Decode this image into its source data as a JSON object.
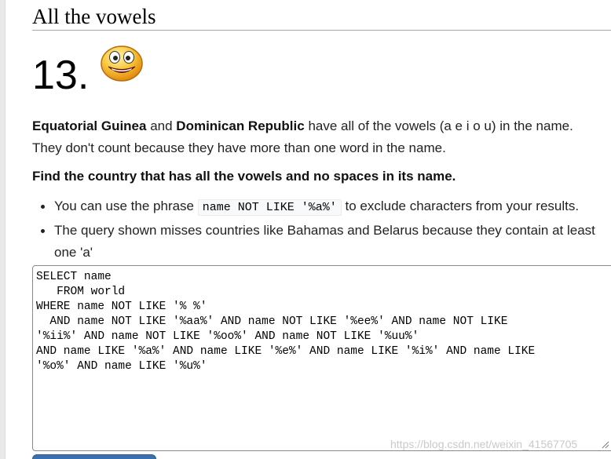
{
  "page": {
    "heading": "All the vowels",
    "question_number": "13.",
    "smiley_icon": "smiley-face-icon"
  },
  "intro": {
    "country1": "Equatorial Guinea",
    "conj": " and ",
    "country2": "Dominican Republic",
    "rest": " have all of the vowels (a e i o u) in the name.",
    "line2": "They don't count because they have more than one word in the name."
  },
  "task": "Find the country that has all the vowels and no spaces in its name.",
  "bullets": {
    "b1_before": "You can use the phrase ",
    "b1_code": "name NOT LIKE '%a%'",
    "b1_after": " to exclude characters from your results.",
    "b2_line1": "The query shown misses countries like Bahamas and Belarus because they contain at least",
    "b2_line2": "one 'a'"
  },
  "editor": {
    "lines": [
      "SELECT name",
      "   FROM world",
      "WHERE name NOT LIKE '% %'",
      "  AND name NOT LIKE '%aa%' AND name NOT LIKE '%ee%' AND name NOT LIKE",
      "'%ii%' AND name NOT LIKE '%oo%' AND name NOT LIKE '%uu%'",
      "AND name LIKE '%a%' AND name LIKE '%e%' AND name LIKE '%i%' AND name LIKE",
      "'%o%' AND name LIKE '%u%'"
    ]
  },
  "watermark": "https://blog.csdn.net/weixin_41567705",
  "colors": {
    "heading_rule": "#a2a9b1",
    "code_bg": "#f8f9fa",
    "button": "#3a6fb0",
    "smiley_face": "#f7b52c"
  }
}
